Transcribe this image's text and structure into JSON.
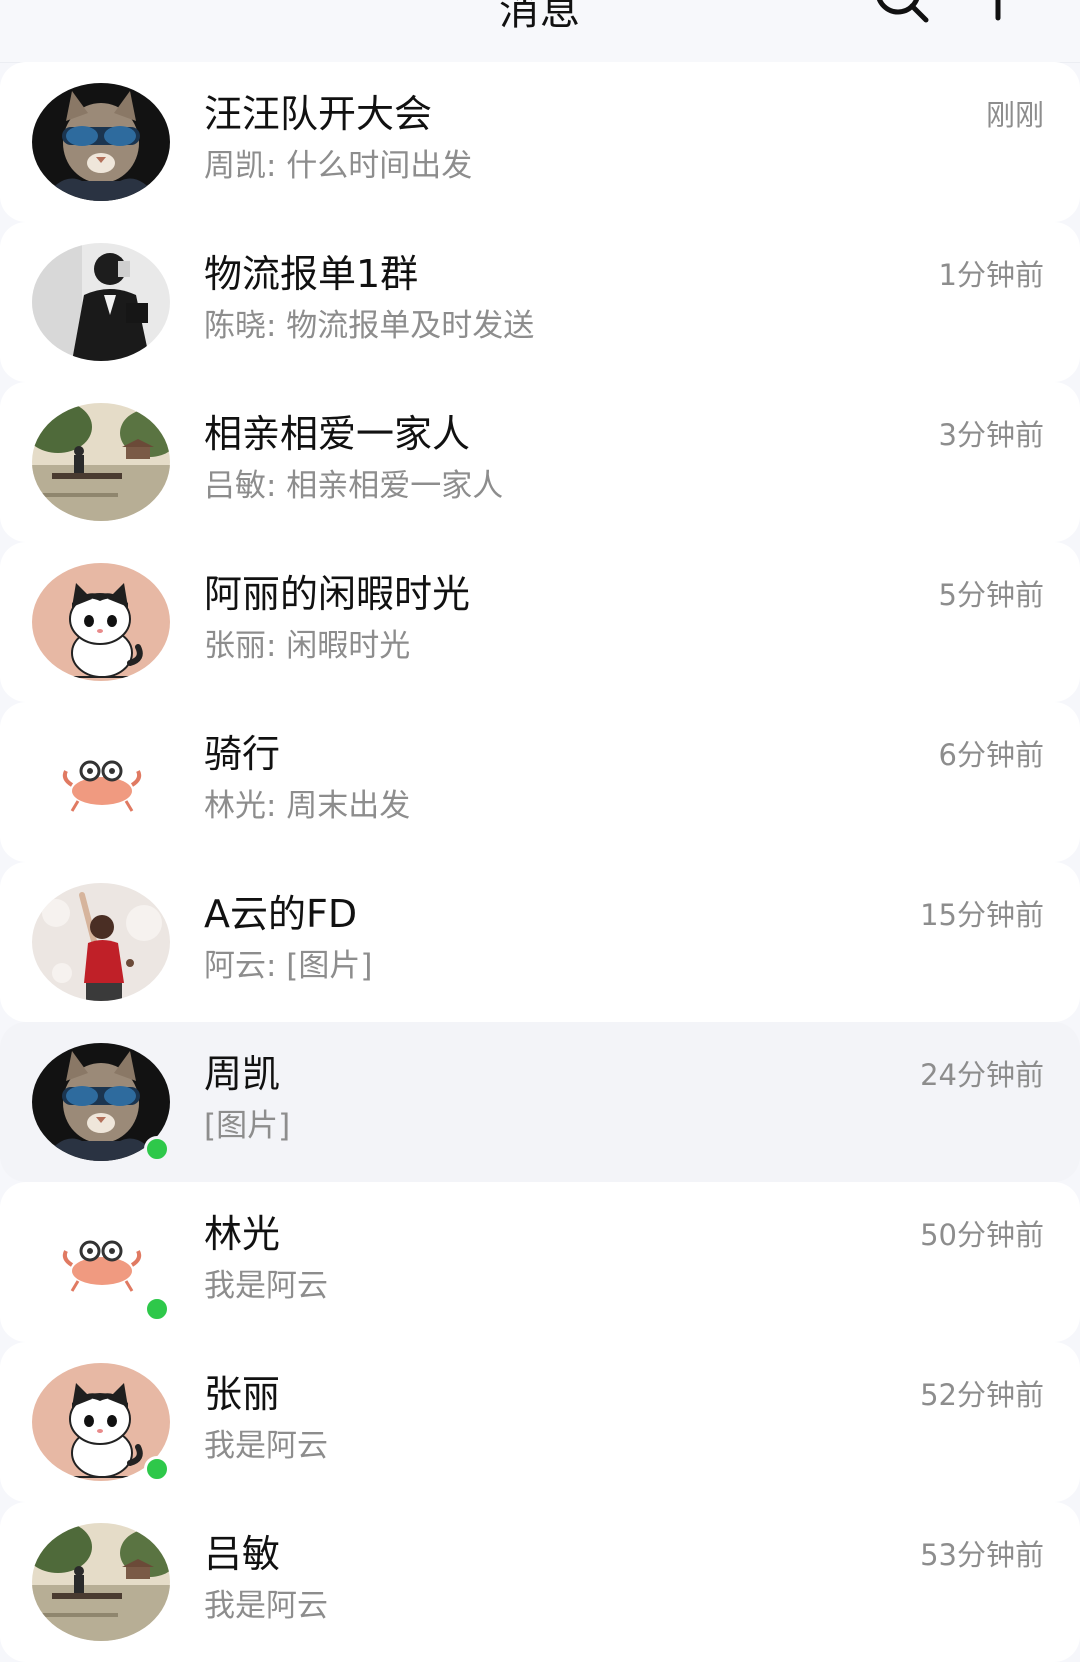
{
  "header": {
    "title": "消息",
    "search_icon": "search-icon",
    "add_icon": "plus-icon"
  },
  "colors": {
    "online": "#2ec84a",
    "active_row": "#f3f4f8",
    "secondary_text": "#8d8d8d"
  },
  "conversations": [
    {
      "name": "汪汪队开大会",
      "preview": "周凯: 什么时间出发",
      "time": "刚刚",
      "avatar": "cat-sunglasses-avatar",
      "online": false,
      "active": false
    },
    {
      "name": "物流报单1群",
      "preview": "陈晓: 物流报单及时发送",
      "time": "1分钟前",
      "avatar": "man-suit-avatar",
      "online": false,
      "active": false
    },
    {
      "name": "相亲相爱一家人",
      "preview": "吕敏: 相亲相爱一家人",
      "time": "3分钟前",
      "avatar": "lake-scenery-avatar",
      "online": false,
      "active": false
    },
    {
      "name": "阿丽的闲暇时光",
      "preview": "张丽: 闲暇时光",
      "time": "5分钟前",
      "avatar": "cartoon-cat-avatar",
      "online": false,
      "active": false
    },
    {
      "name": "骑行",
      "preview": "林光: 周末出发",
      "time": "6分钟前",
      "avatar": "crab-avatar",
      "online": false,
      "active": false
    },
    {
      "name": "A云的FD",
      "preview": "阿云: [图片]",
      "time": "15分钟前",
      "avatar": "girl-red-sweater-avatar",
      "online": false,
      "active": false
    },
    {
      "name": "周凯",
      "preview": "[图片]",
      "time": "24分钟前",
      "avatar": "cat-sunglasses-avatar",
      "online": true,
      "active": true
    },
    {
      "name": "林光",
      "preview": "我是阿云",
      "time": "50分钟前",
      "avatar": "crab-avatar",
      "online": true,
      "active": false
    },
    {
      "name": "张丽",
      "preview": "我是阿云",
      "time": "52分钟前",
      "avatar": "cartoon-cat-avatar",
      "online": true,
      "active": false
    },
    {
      "name": "吕敏",
      "preview": "我是阿云",
      "time": "53分钟前",
      "avatar": "lake-scenery-avatar",
      "online": false,
      "active": false
    }
  ]
}
